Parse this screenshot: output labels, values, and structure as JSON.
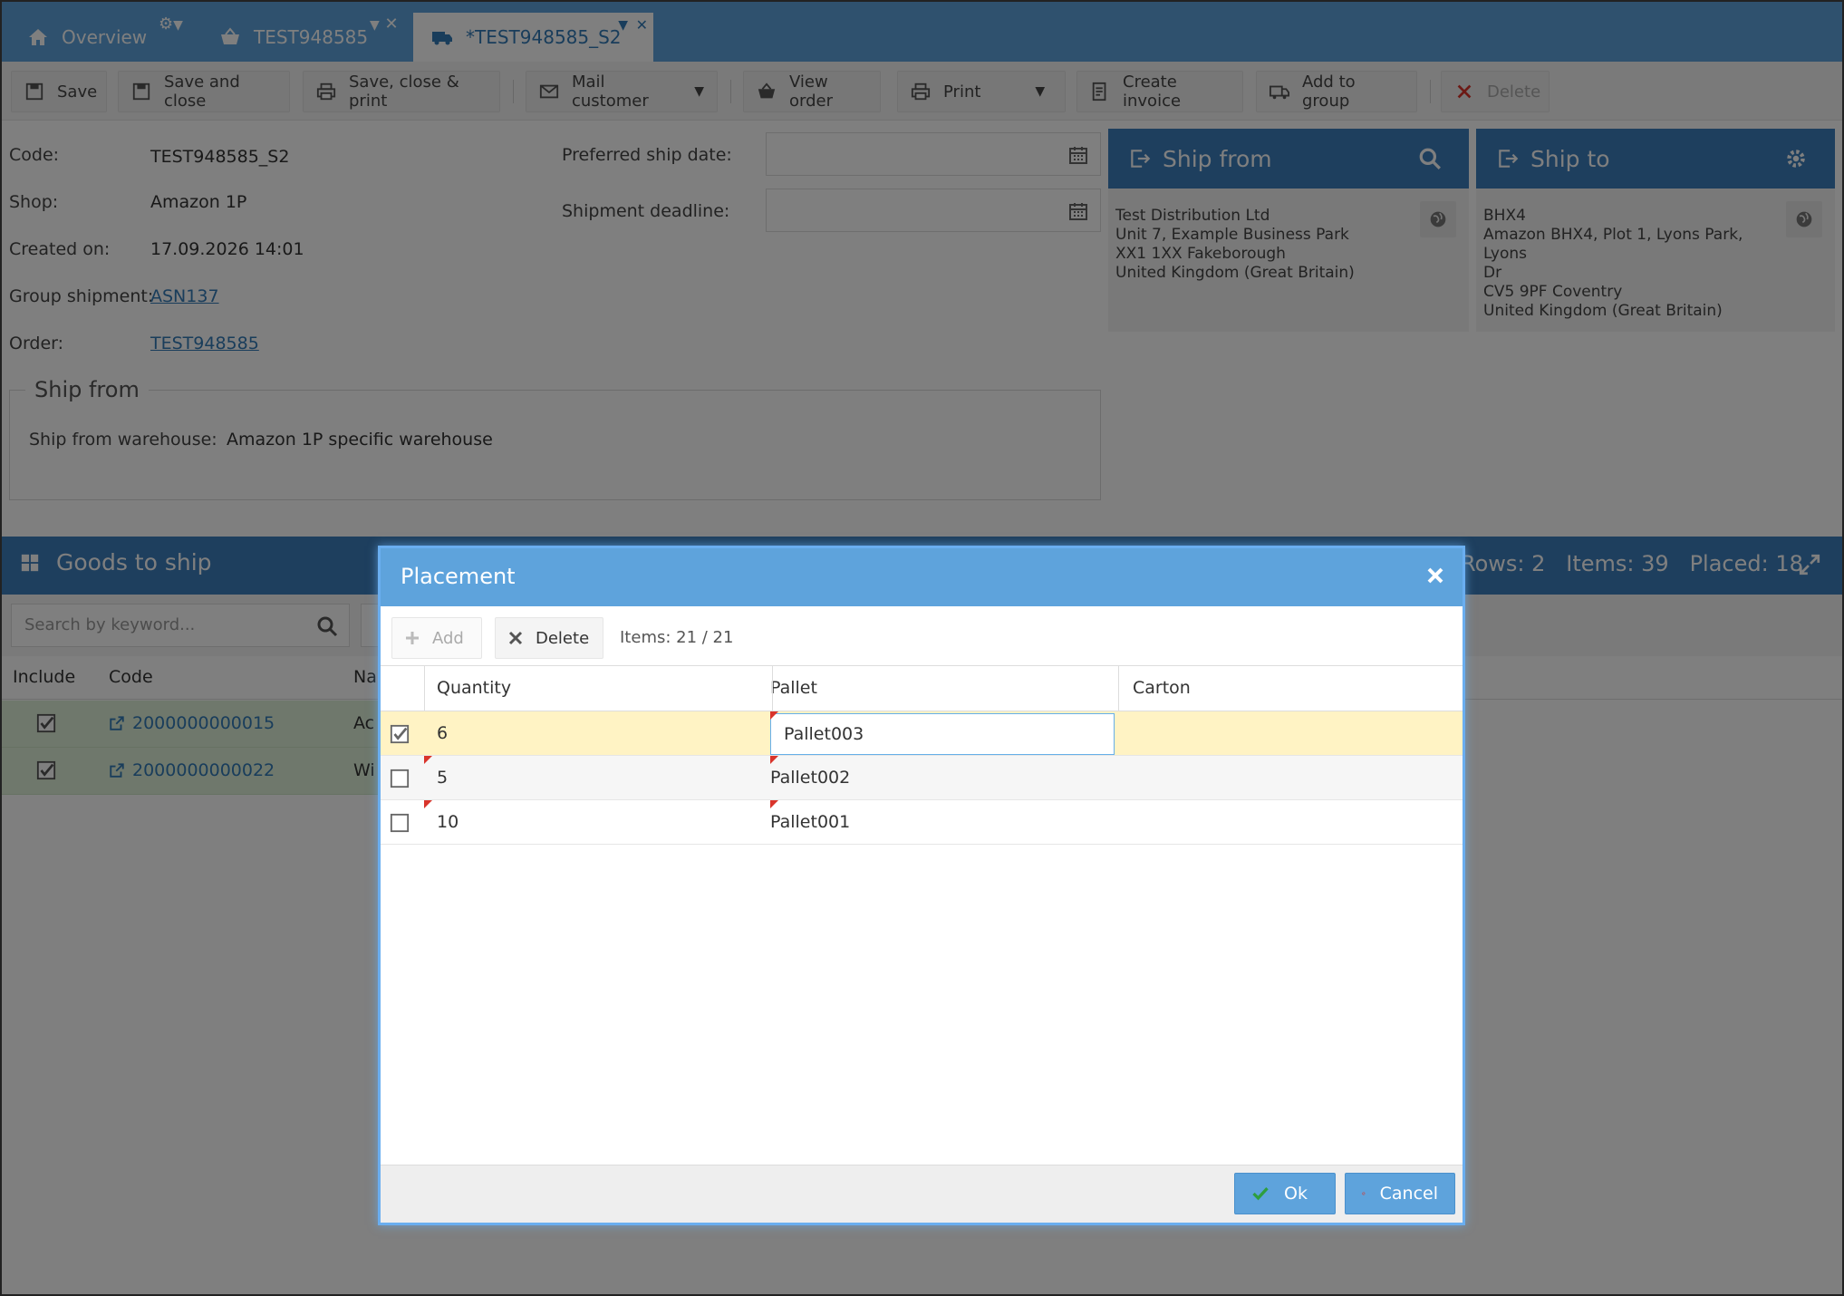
{
  "tabs": [
    {
      "label": "Overview",
      "icon": "home-icon"
    },
    {
      "label": "TEST948585",
      "icon": "basket-icon"
    },
    {
      "label": "*TEST948585_S2",
      "icon": "truck-icon"
    }
  ],
  "toolbar": {
    "save": "Save",
    "save_close": "Save and close",
    "save_close_print": "Save, close & print",
    "mail_customer": "Mail customer",
    "view_order": "View order",
    "print": "Print",
    "create_invoice": "Create invoice",
    "add_to_group": "Add to group",
    "delete": "Delete"
  },
  "details": {
    "code_label": "Code:",
    "code": "TEST948585_S2",
    "shop_label": "Shop:",
    "shop": "Amazon 1P",
    "created_label": "Created on:",
    "created": "17.09.2026 14:01",
    "group_label": "Group shipment:",
    "group": "ASN137",
    "order_label": "Order:",
    "order": "TEST948585",
    "pref_date_label": "Preferred ship date:",
    "deadline_label": "Shipment deadline:"
  },
  "ship_from_section": {
    "legend": "Ship from",
    "warehouse_label": "Ship from warehouse:",
    "warehouse": "Amazon 1P specific warehouse"
  },
  "ship_from_panel": {
    "title": "Ship from",
    "lines": [
      "Test Distribution Ltd",
      "Unit 7, Example Business Park",
      "XX1 1XX Fakeborough",
      "United Kingdom (Great Britain)"
    ]
  },
  "ship_to_panel": {
    "title": "Ship to",
    "lines": [
      "BHX4",
      "Amazon BHX4, Plot 1, Lyons Park, Lyons",
      "Dr",
      "CV5 9PF Coventry",
      "United Kingdom (Great Britain)"
    ]
  },
  "goods": {
    "title": "Goods to ship",
    "stats": "Rows: 2   Items: 39   Placed: 18",
    "search_placeholder": "Search by keyword...",
    "columns": [
      "Include",
      "Code",
      "Na"
    ],
    "rows": [
      {
        "code": "2000000000015",
        "name": "Ac"
      },
      {
        "code": "2000000000022",
        "name": "Wi"
      }
    ]
  },
  "modal": {
    "title": "Placement",
    "add": "Add",
    "delete": "Delete",
    "items": "Items: 21 / 21",
    "columns": {
      "quantity": "Quantity",
      "pallet": "Pallet",
      "carton": "Carton"
    },
    "rows": [
      {
        "quantity": "6",
        "pallet": "Pallet003",
        "checked": true
      },
      {
        "quantity": "5",
        "pallet": "Pallet002",
        "checked": false
      },
      {
        "quantity": "10",
        "pallet": "Pallet001",
        "checked": false
      }
    ],
    "ok": "Ok",
    "cancel": "Cancel"
  },
  "colors": {
    "accent": "#5ea3dc",
    "header_dark": "#3d7fbd",
    "selected_row": "#fff3c4",
    "included_row": "#dff0d8"
  }
}
